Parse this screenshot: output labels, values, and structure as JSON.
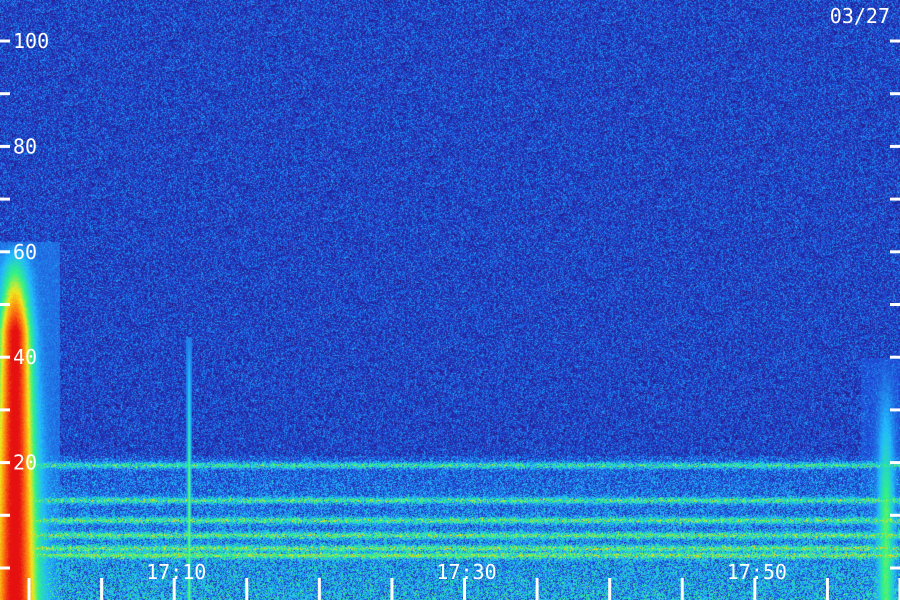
{
  "date_label": "03/27",
  "colors": {
    "background": "#2a0f6a",
    "ticks": "#ffffff",
    "labels": "#ffffff"
  },
  "chart_data": {
    "type": "heatmap",
    "title": "",
    "xlabel": "",
    "ylabel": "",
    "y_ticks": [
      {
        "value": 100,
        "label": "100"
      },
      {
        "value": 80,
        "label": "80"
      },
      {
        "value": 60,
        "label": "60"
      },
      {
        "value": 40,
        "label": "40"
      },
      {
        "value": 20,
        "label": "20"
      }
    ],
    "y_minor_ticks": [
      90,
      70,
      50,
      30,
      10,
      0
    ],
    "ylim": [
      0,
      105
    ],
    "x_ticks": [
      {
        "value": "17:10",
        "label": "17:10"
      },
      {
        "value": "17:30",
        "label": "17:30"
      },
      {
        "value": "17:50",
        "label": "17:50"
      }
    ],
    "x_minor_ticks": [
      "17:00",
      "17:05",
      "17:15",
      "17:20",
      "17:25",
      "17:35",
      "17:40",
      "17:45",
      "17:55",
      "18:00"
    ],
    "xlim": [
      "16:58",
      "18:00"
    ],
    "colormap": [
      "#2a0f6a",
      "#1f3fd0",
      "#22b8ff",
      "#2ef28a",
      "#f2e81c",
      "#ff7a10",
      "#e61010"
    ],
    "features": [
      {
        "name": "",
        "time": "16:59",
        "y_min": 0,
        "y_max": 62
      },
      {
        "name": "",
        "time": "17:11",
        "y_min": 0,
        "y_max": 44
      },
      {
        "name": "",
        "time": "17:59",
        "y_min": 0,
        "y_max": 40
      }
    ]
  }
}
